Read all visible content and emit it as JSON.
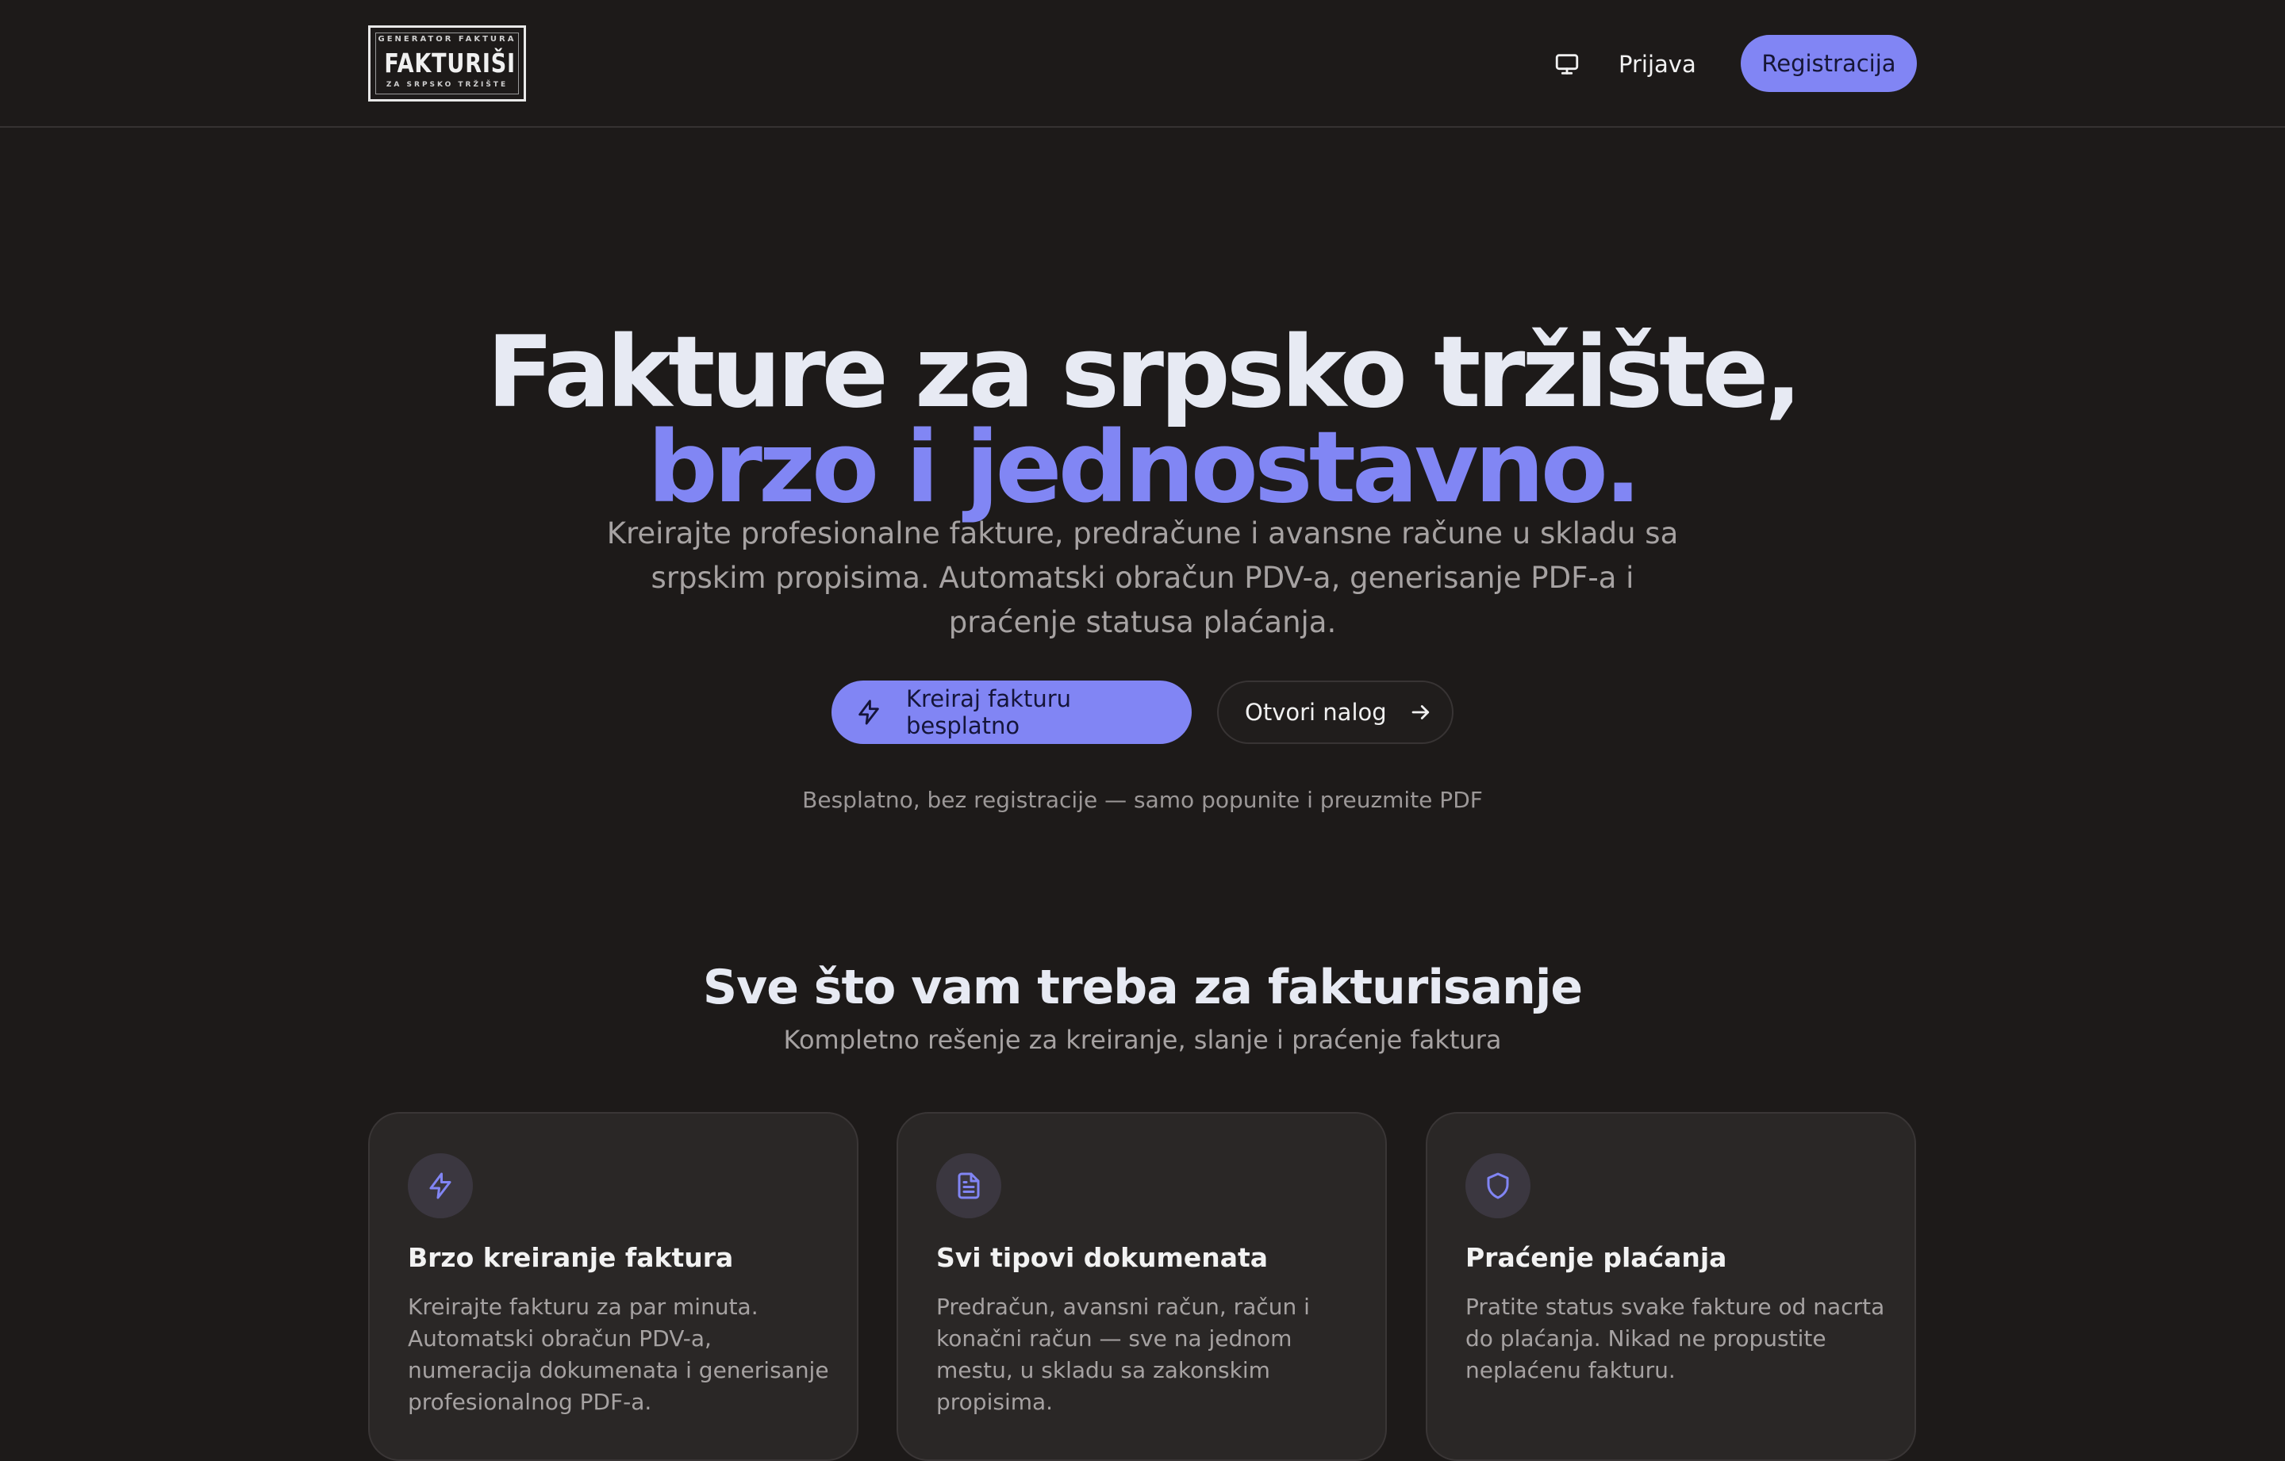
{
  "header": {
    "logo": {
      "top": "GENERATOR FAKTURA",
      "main": "FAKTURIŠI",
      "bottom": "ZA SRPSKO TRŽIŠTE"
    },
    "theme_toggle_icon": "monitor-icon",
    "login_label": "Prijava",
    "register_label": "Registracija"
  },
  "hero": {
    "title_line1": "Fakture za srpsko tržište,",
    "title_line2": "brzo i jednostavno.",
    "subtitle": "Kreirajte profesionalne fakture, predračune i avansne račune u skladu sa srpskim propisima. Automatski obračun PDV-a, generisanje PDF-a i praćenje statusa plaćanja.",
    "cta_primary": {
      "label": "Kreiraj fakturu besplatno",
      "icon": "lightning-icon"
    },
    "cta_secondary": {
      "label": "Otvori nalog",
      "icon": "arrow-right-icon"
    },
    "note": "Besplatno, bez registracije — samo popunite i preuzmite PDF"
  },
  "features": {
    "title": "Sve što vam treba za fakturisanje",
    "subtitle": "Kompletno rešenje za kreiranje, slanje i praćenje faktura",
    "cards": [
      {
        "icon": "lightning-icon",
        "title": "Brzo kreiranje faktura",
        "text": "Kreirajte fakturu za par minuta. Automatski obračun PDV-a, numeracija dokumenata i generisanje profesionalnog PDF-a."
      },
      {
        "icon": "document-icon",
        "title": "Svi tipovi dokumenata",
        "text": "Predračun, avansni račun, račun i konačni račun — sve na jednom mestu, u skladu sa zakonskim propisima."
      },
      {
        "icon": "shield-icon",
        "title": "Praćenje plaćanja",
        "text": "Pratite status svake fakture od nacrta do plaćanja. Nikad ne propustite neplaćenu fakturu."
      }
    ]
  },
  "colors": {
    "background": "#1d1a19",
    "accent": "#8185f4",
    "card": "#2a2726",
    "text": "#e7eaf3",
    "muted": "#a6a2a2"
  }
}
